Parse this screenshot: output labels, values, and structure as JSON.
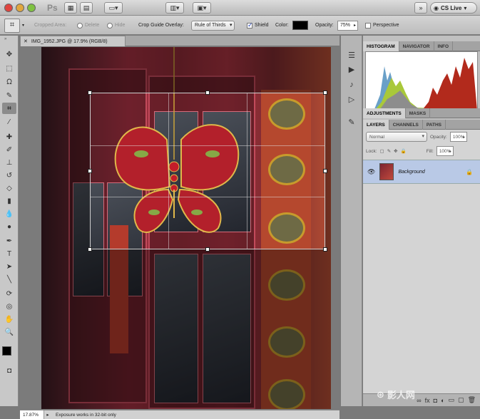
{
  "app": {
    "logo": "Ps",
    "cs_live": "CS Live"
  },
  "options": {
    "cropped_area_label": "Cropped Area:",
    "delete_label": "Delete",
    "hide_label": "Hide",
    "overlay_label": "Crop Guide Overlay:",
    "overlay_value": "Rule of Thirds",
    "shield_label": "Shield",
    "color_label": "Color:",
    "shield_color": "#000000",
    "opacity_label": "Opacity:",
    "opacity_value": "75%",
    "perspective_label": "Perspective"
  },
  "document": {
    "tab_title": "IMG_1952.JPG @ 17.9% (RGB/8)"
  },
  "panels": {
    "top_tabs": [
      "HISTOGRAM",
      "NAVIGATOR",
      "INFO"
    ],
    "adj_tabs": [
      "ADJUSTMENTS",
      "MASKS"
    ],
    "layer_tabs": [
      "LAYERS",
      "CHANNELS",
      "PATHS"
    ],
    "blend_mode": "Normal",
    "opacity_label": "Opacity:",
    "opacity_value": "100%",
    "lock_label": "Lock:",
    "fill_label": "Fill:",
    "fill_value": "100%",
    "layer_name": "Background"
  },
  "status": {
    "zoom": "17.87%",
    "message": "Exposure works in 32-bit only"
  },
  "watermark": "影人网"
}
